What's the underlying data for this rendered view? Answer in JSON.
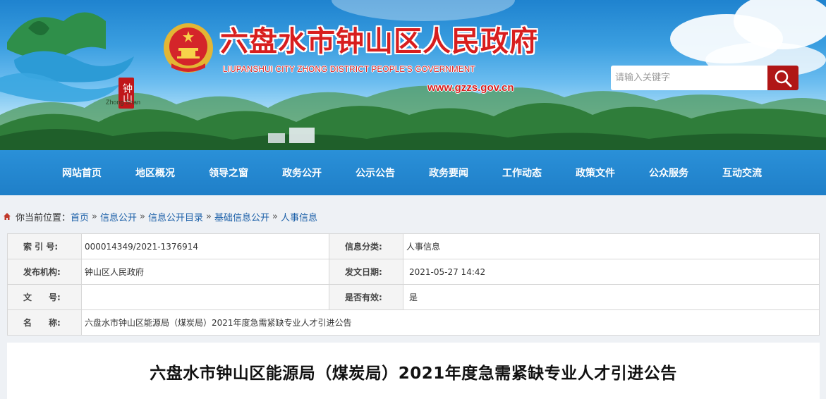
{
  "header": {
    "title": "六盘水市钟山区人民政府",
    "subtitle": "LIUPANSHUI CITY ZHONG DISTRICT PEOPLE'S GOVERNMENT",
    "url": "www.gzzs.gov.cn",
    "logo_brush_text": "钟山",
    "logo_tag": "Zhong Shan",
    "search_placeholder": "请输入关键字"
  },
  "nav": {
    "items": [
      "网站首页",
      "地区概况",
      "领导之窗",
      "政务公开",
      "公示公告",
      "政务要闻",
      "工作动态",
      "政策文件",
      "公众服务",
      "互动交流"
    ]
  },
  "breadcrumb": {
    "prefix": "你当前位置：",
    "items": [
      "首页",
      "信息公开",
      "信息公开目录",
      "基础信息公开",
      "人事信息"
    ],
    "separator": "»"
  },
  "info": {
    "index_label": "索 引 号:",
    "index_value": "000014349/2021-1376914",
    "category_label": "信息分类:",
    "category_value": "人事信息",
    "publisher_label": "发布机构:",
    "publisher_value": "钟山区人民政府",
    "date_label": "发文日期:",
    "date_value": "2021-05-27 14:42",
    "docno_label": "文　　号:",
    "docno_value": "",
    "valid_label": "是否有效:",
    "valid_value": "是",
    "name_label": "名　　称:",
    "name_value": "六盘水市钟山区能源局（煤炭局）2021年度急需紧缺专业人才引进公告"
  },
  "article": {
    "title": "六盘水市钟山区能源局（煤炭局）2021年度急需紧缺专业人才引进公告"
  },
  "colors": {
    "accent_red": "#d81e1e",
    "nav_blue": "#2a90d8",
    "link_blue": "#1a5fa8"
  },
  "icons": [
    "national-emblem-icon",
    "search-icon",
    "home-icon"
  ]
}
